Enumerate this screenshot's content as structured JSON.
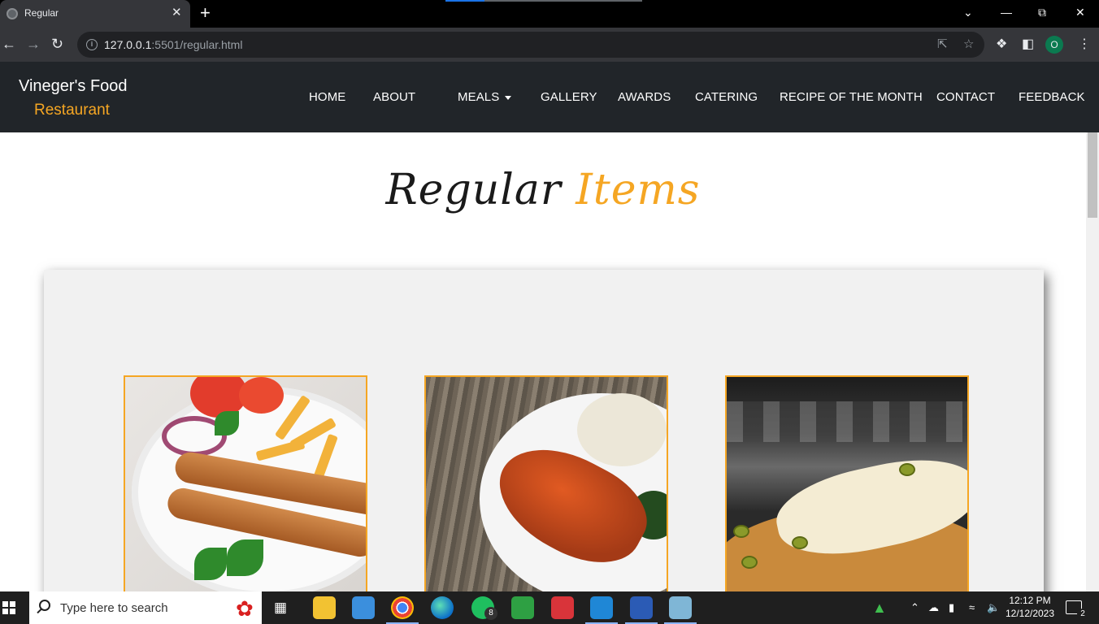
{
  "browser": {
    "tab_title": "Regular",
    "tab_close": "✕",
    "new_tab": "+",
    "url_host": "127.0.0.1",
    "url_path": ":5501/regular.html",
    "profile_initial": "O"
  },
  "site": {
    "brand_line1": "Vineger's Food",
    "brand_line2": "Restaurant",
    "menu": [
      "HOME",
      "ABOUT",
      "MEALS",
      "GALLERY",
      "AWARDS",
      "CATERING",
      "RECIPE OF THE MONTH",
      "CONTACT",
      "FEEDBACK"
    ],
    "page_title_part1": "Regular",
    "page_title_part2": "Items",
    "dishes": [
      "kebab-plate",
      "fried-fish-plate",
      "cheese-pizza"
    ],
    "accent_color": "#f5a623"
  },
  "taskbar": {
    "search_placeholder": "Type here to search",
    "whatsapp_badge": "8",
    "time": "12:12 PM",
    "date": "12/12/2023",
    "notification_count": "2"
  }
}
